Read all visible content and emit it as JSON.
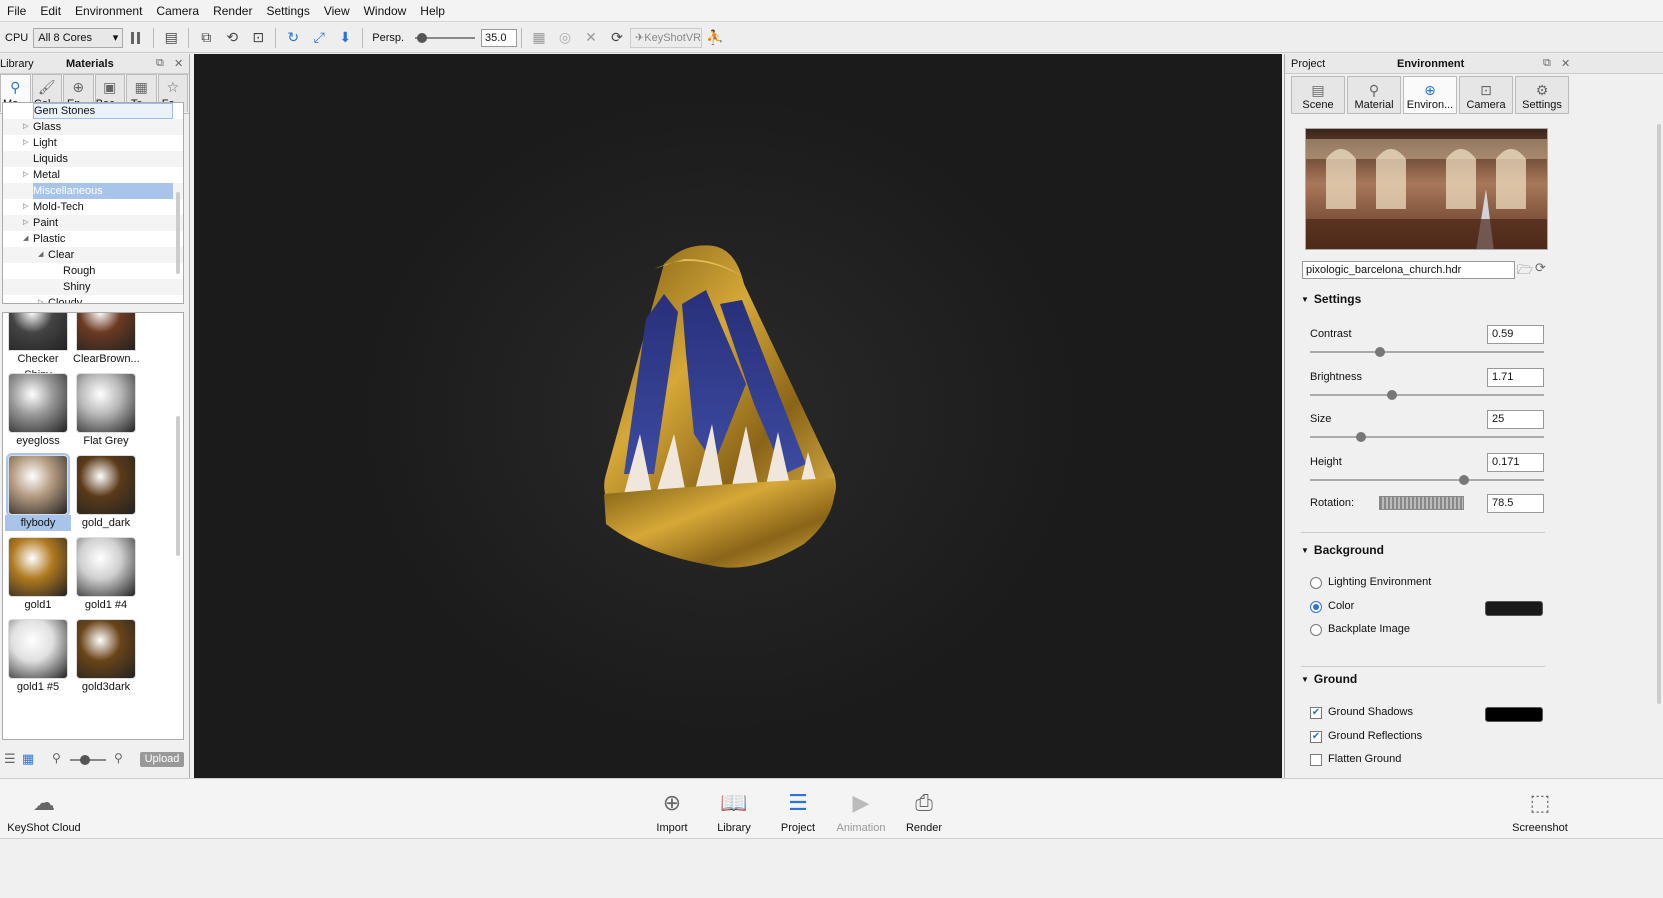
{
  "menu": [
    "File",
    "Edit",
    "Environment",
    "Camera",
    "Render",
    "Settings",
    "View",
    "Window",
    "Help"
  ],
  "toolbar": {
    "device": "CPU",
    "cores": "All 8 Cores",
    "projection": "Persp.",
    "fov": "35.0",
    "vr": "KeyShotVR"
  },
  "library": {
    "title": "Library",
    "heading": "Materials",
    "tabs": [
      "Ma...",
      "Col...",
      "En...",
      "Bac...",
      "Te...",
      "Fa..."
    ],
    "tree": [
      {
        "label": "Gem Stones",
        "indent": 0,
        "arrow": "",
        "state": "hl"
      },
      {
        "label": "Glass",
        "indent": 0,
        "arrow": "▷",
        "state": ""
      },
      {
        "label": "Light",
        "indent": 0,
        "arrow": "▷",
        "state": ""
      },
      {
        "label": "Liquids",
        "indent": 0,
        "arrow": "",
        "state": ""
      },
      {
        "label": "Metal",
        "indent": 0,
        "arrow": "▷",
        "state": ""
      },
      {
        "label": "Miscellaneous",
        "indent": 0,
        "arrow": "",
        "state": "sel"
      },
      {
        "label": "Mold-Tech",
        "indent": 0,
        "arrow": "▷",
        "state": ""
      },
      {
        "label": "Paint",
        "indent": 0,
        "arrow": "▷",
        "state": ""
      },
      {
        "label": "Plastic",
        "indent": 0,
        "arrow": "◢",
        "state": ""
      },
      {
        "label": "Clear",
        "indent": 1,
        "arrow": "◢",
        "state": ""
      },
      {
        "label": "Rough",
        "indent": 2,
        "arrow": "",
        "state": ""
      },
      {
        "label": "Shiny",
        "indent": 2,
        "arrow": "",
        "state": ""
      },
      {
        "label": "Cloudy",
        "indent": 1,
        "arrow": "▷",
        "state": ""
      }
    ],
    "thumbnails": [
      {
        "name": "Checker Shiny",
        "color": "#444",
        "selected": false
      },
      {
        "name": "ClearBrown...",
        "color": "#6b3a22",
        "selected": false
      },
      {
        "name": "eyegloss",
        "color": "#9a9a9a",
        "selected": false
      },
      {
        "name": "Flat Grey",
        "color": "#b8b8b8",
        "selected": false
      },
      {
        "name": "flybody",
        "color": "#b49a80",
        "selected": true
      },
      {
        "name": "gold_dark",
        "color": "#5a3a18",
        "selected": false
      },
      {
        "name": "gold1",
        "color": "#b07a20",
        "selected": false
      },
      {
        "name": "gold1 #4",
        "color": "#d0d0d0",
        "selected": false
      },
      {
        "name": "gold1 #5",
        "color": "#e0e0e0",
        "selected": false
      },
      {
        "name": "gold3dark",
        "color": "#6a4418",
        "selected": false
      }
    ],
    "upload": "Upload"
  },
  "project": {
    "title": "Project",
    "heading": "Environment",
    "tabs": [
      "Scene",
      "Material",
      "Environ...",
      "Camera",
      "Settings"
    ],
    "hdr_file": "pixologic_barcelona_church.hdr",
    "settings_title": "Settings",
    "params": [
      {
        "label": "Contrast",
        "value": "0.59",
        "knob": 0.3
      },
      {
        "label": "Brightness",
        "value": "1.71",
        "knob": 0.35
      },
      {
        "label": "Size",
        "value": "25",
        "knob": 0.22
      },
      {
        "label": "Height",
        "value": "0.171",
        "knob": 0.66
      }
    ],
    "rotation": {
      "label": "Rotation:",
      "value": "78.5"
    },
    "background_title": "Background",
    "background_options": [
      {
        "label": "Lighting Environment",
        "on": false
      },
      {
        "label": "Color",
        "on": true
      },
      {
        "label": "Backplate Image",
        "on": false
      }
    ],
    "ground_title": "Ground",
    "ground_options": [
      {
        "label": "Ground Shadows",
        "on": true
      },
      {
        "label": "Ground Reflections",
        "on": true
      },
      {
        "label": "Flatten Ground",
        "on": false
      }
    ]
  },
  "bottom": {
    "cloud": "KeyShot Cloud",
    "import": "Import",
    "library": "Library",
    "project": "Project",
    "animation": "Animation",
    "render": "Render",
    "screenshot": "Screenshot"
  }
}
